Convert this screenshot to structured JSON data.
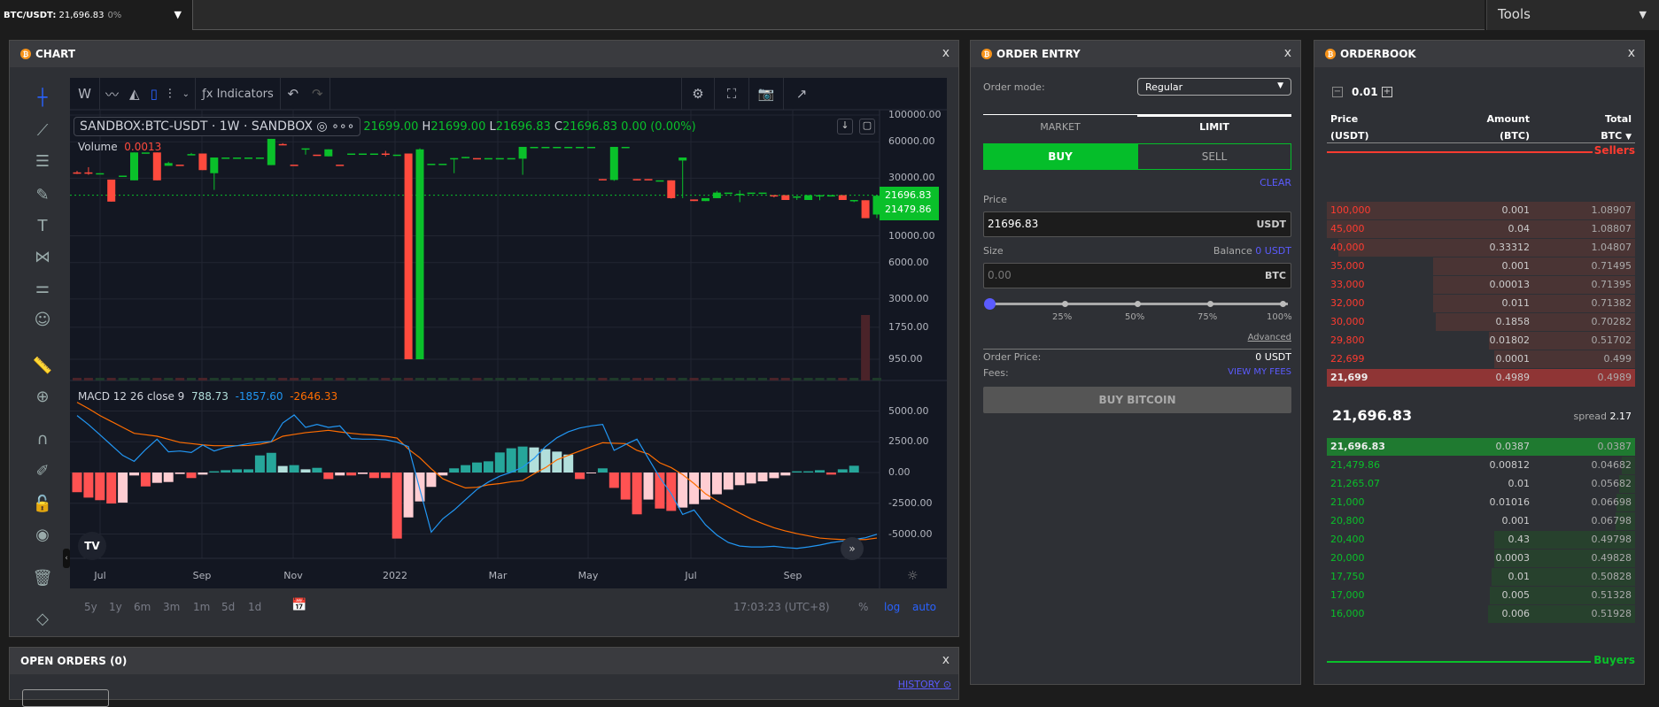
{
  "topbar": {
    "pair": "BTC/USDT:",
    "price": "21,696.83",
    "change": "0%",
    "tools": "Tools"
  },
  "chart_panel": {
    "title": "CHART",
    "close": "x",
    "toolbar": {
      "interval": "W",
      "indicators": "Indicators"
    },
    "legend": {
      "symbol": "SANDBOX:BTC-USDT",
      "interval": "1W",
      "exchange": "SANDBOX",
      "o_val": "21699.00",
      "h": "H",
      "h_val": "21699.00",
      "l": "L",
      "l_val": "21696.83",
      "c": "C",
      "c_val": "21696.83",
      "chg": "0.00 (0.00%)"
    },
    "volume": {
      "label": "Volume",
      "value": "0.0013"
    },
    "macd": {
      "label": "MACD 12 26 close 9",
      "hist": "788.73",
      "macd": "-1857.60",
      "signal": "-2646.33"
    },
    "price_ticks": [
      "100000.00",
      "60000.00",
      "30000.00",
      "10000.00",
      "6000.00",
      "3000.00",
      "1750.00",
      "950.00"
    ],
    "price_labels": [
      "21696.83",
      "21479.86"
    ],
    "macd_ticks": [
      "5000.00",
      "2500.00",
      "0.00",
      "-2500.00",
      "-5000.00"
    ],
    "time_ticks": [
      "Jul",
      "Sep",
      "Nov",
      "2022",
      "Mar",
      "May",
      "Jul",
      "Sep"
    ],
    "ranges": [
      "5y",
      "1y",
      "6m",
      "3m",
      "1m",
      "5d",
      "1d"
    ],
    "clock": "17:03:23 (UTC+8)",
    "pct": "%",
    "log": "log",
    "auto": "auto"
  },
  "chart_data": {
    "type": "candlestick",
    "scale": "log",
    "ylim": [
      950,
      100000
    ],
    "colors": {
      "up": "#0ac02a",
      "down": "#ff4a3d",
      "macd": "#2196f3",
      "signal": "#ff6d00"
    },
    "candles": [
      [
        33500,
        34500,
        32500,
        33000
      ],
      [
        33500,
        37000,
        32000,
        33000
      ],
      [
        33000,
        33000,
        33000,
        33000
      ],
      [
        29200,
        29200,
        19200,
        19200
      ],
      [
        31200,
        31500,
        31000,
        31500
      ],
      [
        28800,
        49000,
        28800,
        49000
      ],
      [
        49000,
        49000,
        49000,
        49000
      ],
      [
        49000,
        49000,
        28800,
        28800
      ],
      [
        38000,
        41000,
        38000,
        40000
      ],
      [
        38800,
        38800,
        38800,
        38700
      ],
      [
        47500,
        48500,
        46500,
        47500
      ],
      [
        48000,
        48000,
        35000,
        35000
      ],
      [
        33000,
        44500,
        24000,
        44500
      ],
      [
        44500,
        44500,
        44500,
        44500
      ],
      [
        44500,
        44500,
        44500,
        44500
      ],
      [
        44500,
        44500,
        44500,
        44500
      ],
      [
        44500,
        44500,
        44500,
        44500
      ],
      [
        38500,
        63500,
        38500,
        63500
      ],
      [
        57500,
        58500,
        57000,
        57000
      ],
      [
        38800,
        38800,
        38800,
        38700
      ],
      [
        53000,
        53000,
        47000,
        53000
      ],
      [
        47000,
        47000,
        47000,
        46900
      ],
      [
        45500,
        52000,
        45500,
        52000
      ],
      [
        38800,
        38800,
        38800,
        38700
      ],
      [
        48000,
        48000,
        48000,
        48000
      ],
      [
        48000,
        48000,
        48000,
        48000
      ],
      [
        48000,
        48000,
        48000,
        48000
      ],
      [
        48000,
        50500,
        45500,
        47000
      ],
      [
        47000,
        47000,
        47000,
        47000
      ],
      [
        48000,
        48000,
        950,
        950
      ],
      [
        950,
        53000,
        950,
        52000
      ],
      [
        39500,
        39500,
        39500,
        39500
      ],
      [
        39500,
        39500,
        39500,
        39500
      ],
      [
        44000,
        44000,
        33000,
        44000
      ],
      [
        44000,
        45000,
        44000,
        45000
      ],
      [
        44000,
        44000,
        44000,
        43900
      ],
      [
        44000,
        44000,
        44000,
        44000
      ],
      [
        44000,
        44000,
        44000,
        44000
      ],
      [
        44000,
        44000,
        44000,
        44000
      ],
      [
        43500,
        54500,
        32000,
        54500
      ],
      [
        54500,
        54500,
        54500,
        54500
      ],
      [
        54500,
        54500,
        54500,
        54500
      ],
      [
        54500,
        54500,
        54500,
        54500
      ],
      [
        54500,
        54500,
        54500,
        54500
      ],
      [
        54500,
        54500,
        54500,
        54500
      ],
      [
        54500,
        54500,
        54500,
        54500
      ],
      [
        29500,
        29500,
        29200,
        29000
      ],
      [
        29000,
        54500,
        28500,
        54500
      ],
      [
        54500,
        54500,
        54500,
        54500
      ],
      [
        29500,
        29500,
        28800,
        29200
      ],
      [
        29500,
        29500,
        29200,
        29000
      ],
      [
        28800,
        28800,
        28800,
        28800
      ],
      [
        28800,
        28800,
        20300,
        20500
      ],
      [
        42000,
        44500,
        20500,
        44500
      ],
      [
        20000,
        20000,
        19400,
        19400
      ],
      [
        19400,
        20500,
        19400,
        20500
      ],
      [
        20500,
        23500,
        20500,
        22800
      ],
      [
        22800,
        22800,
        22800,
        22800
      ],
      [
        21700,
        23800,
        19000,
        22300
      ],
      [
        22800,
        22800,
        22800,
        22800
      ],
      [
        22800,
        22800,
        22800,
        22800
      ],
      [
        21700,
        21700,
        20800,
        21600
      ],
      [
        21700,
        21700,
        19800,
        19800
      ],
      [
        21200,
        21200,
        19800,
        21200
      ],
      [
        19800,
        21700,
        19800,
        21700
      ],
      [
        21200,
        21700,
        19700,
        21700
      ],
      [
        21700,
        21700,
        21700,
        21700
      ],
      [
        21700,
        21700,
        19800,
        19800
      ],
      [
        19700,
        19800,
        19000,
        19800
      ],
      [
        19700,
        19700,
        14000,
        14000
      ],
      [
        15000,
        21700,
        14000,
        21480
      ],
      [
        21480,
        24000,
        21480,
        21700
      ]
    ],
    "volume_spike": {
      "candle": 69,
      "value": "high"
    },
    "macd_hist": [
      -1600,
      -2040,
      -2250,
      -2520,
      -2450,
      -240,
      -1130,
      -840,
      -770,
      -120,
      -450,
      -170,
      100,
      190,
      260,
      260,
      1390,
      1600,
      530,
      600,
      260,
      380,
      -530,
      -240,
      -240,
      -120,
      -450,
      -450,
      -5370,
      -3650,
      -2350,
      -1170,
      -240,
      340,
      600,
      815,
      910,
      1630,
      1970,
      2110,
      2040,
      1900,
      1700,
      1460,
      -530,
      -70,
      340,
      -1250,
      -2200,
      -3400,
      -2200,
      -2930,
      -3120,
      -2850,
      -2570,
      -2200,
      -1770,
      -1390,
      -1030,
      -890,
      -720,
      -460,
      -240,
      100,
      100,
      190,
      -170,
      260,
      550
    ],
    "macd_line": [
      4630,
      3900,
      3070,
      2230,
      1390,
      910,
      1870,
      2710,
      1680,
      1750,
      1630,
      2230,
      1750,
      2040,
      2180,
      2350,
      2470,
      2520,
      4030,
      4680,
      3670,
      3910,
      3670,
      3790,
      2760,
      2710,
      2710,
      2660,
      2470,
      2110,
      -1370,
      -4850,
      -3770,
      -3050,
      -2210,
      -1370,
      -770,
      -290,
      20,
      430,
      1150,
      2110,
      2830,
      3310,
      3620,
      3790,
      3910,
      1800,
      2280,
      2710,
      1150,
      -410,
      -1730,
      -3410,
      -3050,
      -4250,
      -5090,
      -5690,
      -5980,
      -6050,
      -6050,
      -6000,
      -6100,
      -6170,
      -6050,
      -5900,
      -5700,
      -5570,
      -5450,
      -5300,
      -5020
    ],
    "signal_line": [
      5710,
      5200,
      4630,
      4150,
      3670,
      3190,
      3070,
      2950,
      2700,
      2450,
      2350,
      2250,
      2180,
      2180,
      2180,
      2200,
      2300,
      2500,
      2950,
      3100,
      3240,
      3330,
      3430,
      3300,
      3190,
      3100,
      3050,
      2950,
      2800,
      1900,
      1200,
      300,
      -500,
      -900,
      -1250,
      -1200,
      -1000,
      -900,
      -750,
      -650,
      -100,
      400,
      1030,
      1400,
      1750,
      2100,
      2420,
      2380,
      2350,
      1800,
      1510,
      790,
      400,
      -170,
      -900,
      -1730,
      -2300,
      -2810,
      -3300,
      -3770,
      -4150,
      -4490,
      -4750,
      -4970,
      -5150,
      -5330,
      -5400,
      -5450,
      -5450,
      -5450,
      -5330
    ],
    "macd_ylim": [
      -6500,
      6500
    ]
  },
  "order_entry": {
    "title": "ORDER ENTRY",
    "close": "x",
    "mode_label": "Order mode:",
    "mode_value": "Regular",
    "tabs": [
      "MARKET",
      "LIMIT"
    ],
    "active_tab": "LIMIT",
    "buy": "BUY",
    "sell": "SELL",
    "clear": "CLEAR",
    "price_label": "Price",
    "price_value": "21696.83",
    "price_unit": "USDT",
    "size_label": "Size",
    "balance_label": "Balance",
    "balance_value": "0 USDT",
    "size_placeholder": "0.00",
    "size_unit": "BTC",
    "slider_marks": [
      "25%",
      "50%",
      "75%",
      "100%"
    ],
    "slider_value": 0,
    "advanced": "Advanced",
    "order_price_label": "Order Price:",
    "order_price_value": "0 USDT",
    "fees_label": "Fees:",
    "fees_link": "VIEW MY FEES",
    "submit": "BUY BITCOIN"
  },
  "orderbook": {
    "title": "ORDERBOOK",
    "close": "x",
    "step": "0.01",
    "headers": {
      "price": "Price",
      "price_unit": "(USDT)",
      "amount": "Amount",
      "amount_unit": "(BTC)",
      "total": "Total",
      "total_unit": "BTC"
    },
    "sellers": "Sellers",
    "buyers": "Buyers",
    "mid_price": "21,696.83",
    "spread_label": "spread",
    "spread_value": "2.17",
    "asks": [
      {
        "price": "100,000",
        "amount": "0.001",
        "total": "1.08907"
      },
      {
        "price": "45,000",
        "amount": "0.04",
        "total": "1.08807"
      },
      {
        "price": "40,000",
        "amount": "0.33312",
        "total": "1.04807"
      },
      {
        "price": "35,000",
        "amount": "0.001",
        "total": "0.71495"
      },
      {
        "price": "33,000",
        "amount": "0.00013",
        "total": "0.71395"
      },
      {
        "price": "32,000",
        "amount": "0.011",
        "total": "0.71382"
      },
      {
        "price": "30,000",
        "amount": "0.1858",
        "total": "0.70282"
      },
      {
        "price": "29,800",
        "amount": "0.01802",
        "total": "0.51702"
      },
      {
        "price": "22,699",
        "amount": "0.0001",
        "total": "0.499"
      },
      {
        "price": "21,699",
        "amount": "0.4989",
        "total": "0.4989"
      }
    ],
    "bids": [
      {
        "price": "21,696.83",
        "amount": "0.0387",
        "total": "0.0387"
      },
      {
        "price": "21,479.86",
        "amount": "0.00812",
        "total": "0.04682"
      },
      {
        "price": "21,265.07",
        "amount": "0.01",
        "total": "0.05682"
      },
      {
        "price": "21,000",
        "amount": "0.01016",
        "total": "0.06698"
      },
      {
        "price": "20,800",
        "amount": "0.001",
        "total": "0.06798"
      },
      {
        "price": "20,400",
        "amount": "0.43",
        "total": "0.49798"
      },
      {
        "price": "20,000",
        "amount": "0.0003",
        "total": "0.49828"
      },
      {
        "price": "17,750",
        "amount": "0.01",
        "total": "0.50828"
      },
      {
        "price": "17,000",
        "amount": "0.005",
        "total": "0.51328"
      },
      {
        "price": "16,000",
        "amount": "0.006",
        "total": "0.51928"
      }
    ]
  },
  "open_orders": {
    "title": "OPEN ORDERS (0)",
    "close": "x",
    "history": "HISTORY"
  }
}
